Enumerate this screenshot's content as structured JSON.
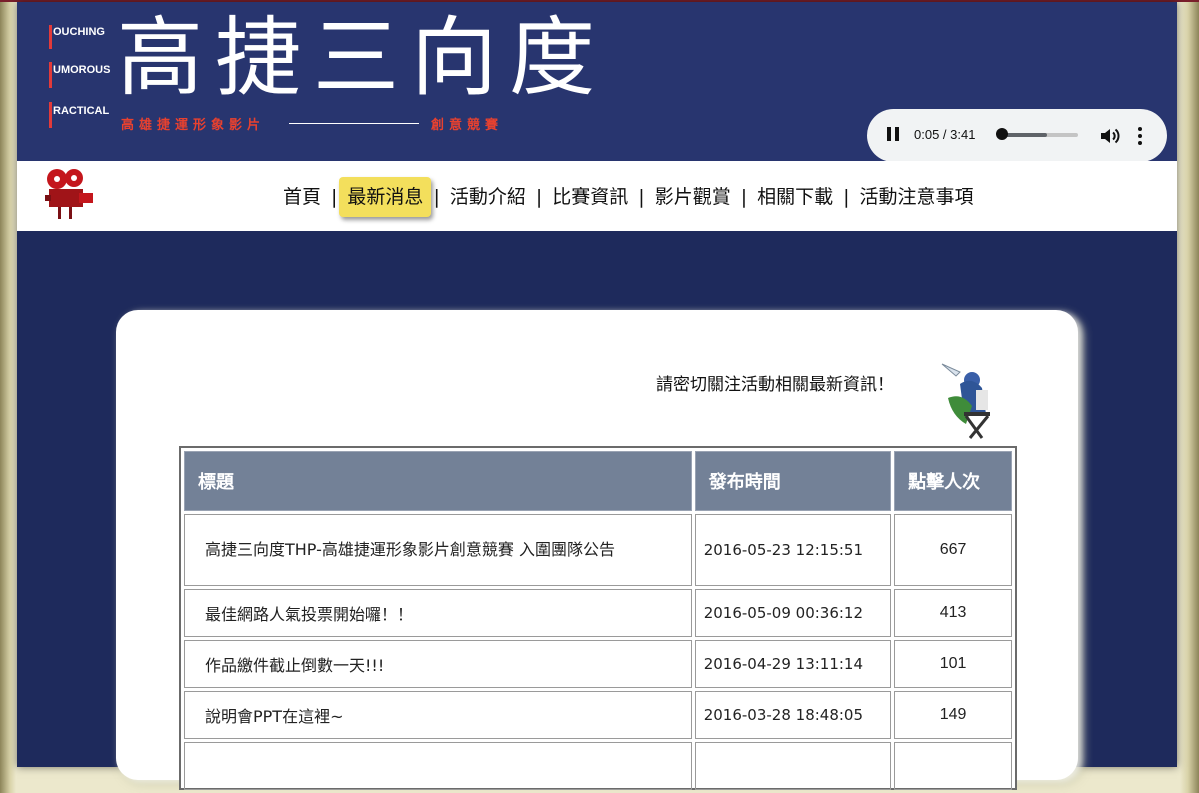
{
  "header": {
    "logo_side": [
      "OUCHING",
      "UMOROUS",
      "RACTICAL"
    ],
    "logo_title": "高捷三向度",
    "logo_sub_left": "高雄捷運形象影片",
    "logo_sub_right": "創意競賽"
  },
  "audio": {
    "time": "0:05 / 3:41",
    "progress": 0.023,
    "buffered": 0.6
  },
  "nav": {
    "items": [
      "首頁",
      "最新消息",
      "活動介紹",
      "比賽資訊",
      "影片觀賞",
      "相關下載",
      "活動注意事項"
    ],
    "separator": "|",
    "active_index": 1
  },
  "main": {
    "notice": "請密切關注活動相關最新資訊！",
    "table": {
      "headers": [
        "標題",
        "發布時間",
        "點擊人次"
      ],
      "rows": [
        {
          "title": "高捷三向度THP-高雄捷運形象影片創意競賽 入圍團隊公告",
          "date": "2016-05-23 12:15:51",
          "clicks": "667"
        },
        {
          "title": "最佳網路人氣投票開始囉！！",
          "date": "2016-05-09 00:36:12",
          "clicks": "413"
        },
        {
          "title": "作品繳件截止倒數一天!!!",
          "date": "2016-04-29 13:11:14",
          "clicks": "101"
        },
        {
          "title": "說明會PPT在這裡~",
          "date": "2016-03-28 18:48:05",
          "clicks": "149"
        },
        {
          "title": "",
          "date": "",
          "clicks": ""
        }
      ]
    }
  },
  "colors": {
    "header_bg": "#28356f",
    "page_bg": "#1e2a5c",
    "nav_active": "#f3df5c",
    "table_header": "#738197",
    "logo_accent": "#e8412f"
  }
}
